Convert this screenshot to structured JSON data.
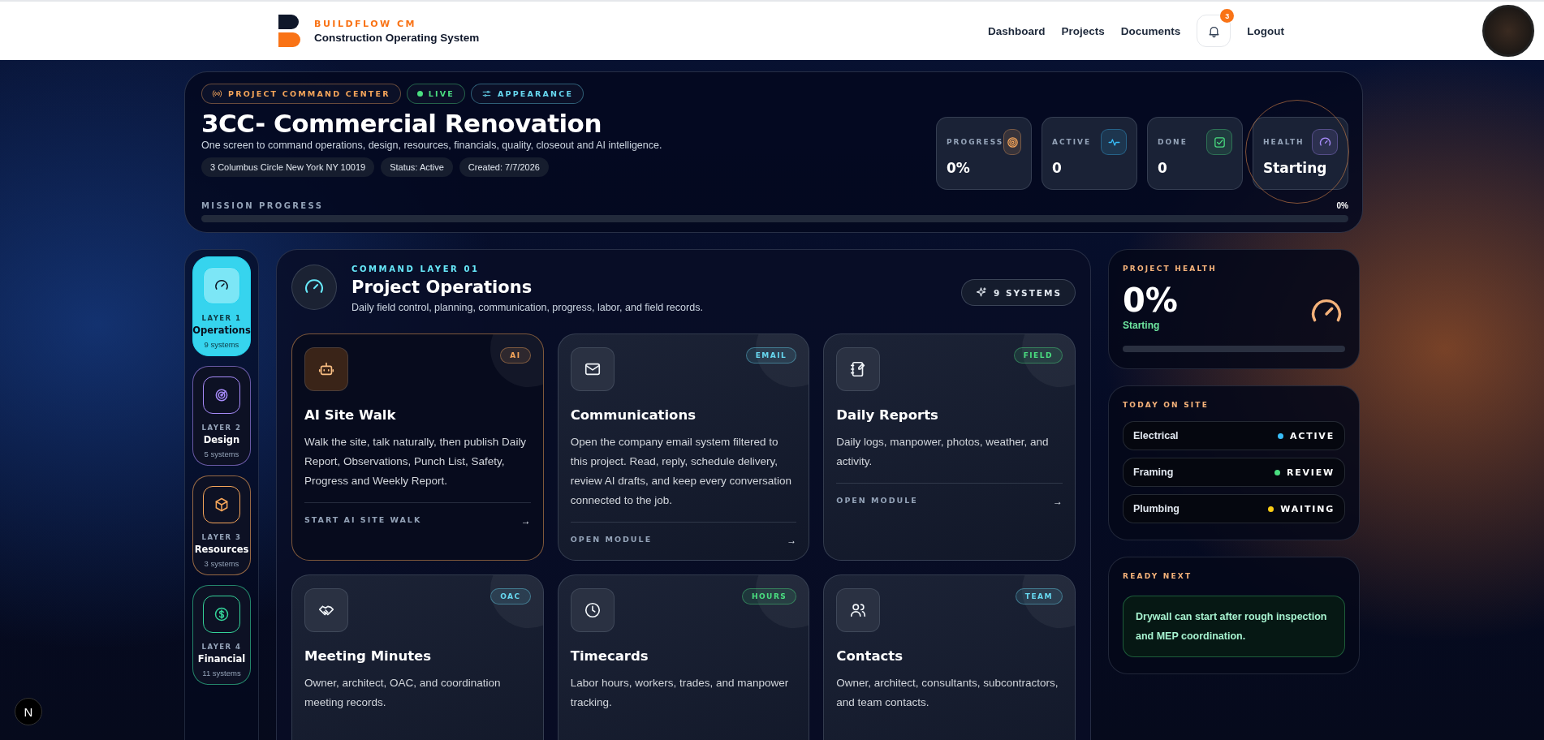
{
  "header": {
    "brand": "BUILDFLOW CM",
    "tagline": "Construction Operating System",
    "nav": [
      "Dashboard",
      "Projects",
      "Documents"
    ],
    "notifications": "3",
    "logout": "Logout"
  },
  "hero": {
    "chips": [
      {
        "label": "PROJECT COMMAND CENTER",
        "color": "#f5a55a"
      },
      {
        "label": "LIVE",
        "color": "#4ade80"
      },
      {
        "label": "APPEARANCE",
        "color": "#67d8f0"
      }
    ],
    "title": "3CC- Commercial Renovation",
    "subtitle": "One screen to command operations, design, resources, financials, quality, closeout and AI intelligence.",
    "meta": [
      "3 Columbus Circle New York NY 10019",
      "Status: Active",
      "Created: 7/7/2026"
    ],
    "stats": [
      {
        "label": "PROGRESS",
        "value": "0%",
        "color": "#f5a55a"
      },
      {
        "label": "ACTIVE",
        "value": "0",
        "color": "#38bdf8"
      },
      {
        "label": "DONE",
        "value": "0",
        "color": "#4ade80"
      },
      {
        "label": "HEALTH",
        "value": "Starting",
        "color": "#a78bfa"
      }
    ],
    "progress_label": "MISSION PROGRESS",
    "progress_reading": "0%",
    "level": 0
  },
  "layers": [
    {
      "layer": "LAYER 1",
      "name": "Operations",
      "count": "9 systems",
      "selected": true,
      "color": "#22d3ee"
    },
    {
      "layer": "LAYER 2",
      "name": "Design",
      "count": "5 systems",
      "selected": false,
      "color": "#a78bfa"
    },
    {
      "layer": "LAYER 3",
      "name": "Resources",
      "count": "3 systems",
      "selected": false,
      "color": "#f5a55a"
    },
    {
      "layer": "LAYER 4",
      "name": "Financial",
      "count": "11 systems",
      "selected": false,
      "color": "#34d399"
    }
  ],
  "operations": {
    "eyebrow": "COMMAND LAYER 01",
    "title": "Project Operations",
    "description": "Daily field control, planning, communication, progress, labor, and field records.",
    "systems": "9 SYSTEMS",
    "cards": [
      {
        "tag": "AI",
        "color": "#f5a55a",
        "title": "AI Site Walk",
        "description": "Walk the site, talk naturally, then publish Daily Report, Observations, Punch List, Safety, Progress and Weekly Report.",
        "action": "START AI SITE WALK",
        "arrow": "→",
        "selected": true
      },
      {
        "tag": "EMAIL",
        "color": "#67d8f0",
        "title": "Communications",
        "description": "Open the company email system filtered to this project. Read, reply, schedule delivery, review AI drafts, and keep every conversation connected to the job.",
        "action": "OPEN MODULE",
        "arrow": "→",
        "selected": false
      },
      {
        "tag": "FIELD",
        "color": "#4ade80",
        "title": "Daily Reports",
        "description": "Daily logs, manpower, photos, weather, and activity.",
        "action": "OPEN MODULE",
        "arrow": "→",
        "selected": false
      },
      {
        "tag": "OAC",
        "color": "#67d8f0",
        "title": "Meeting Minutes",
        "description": "Owner, architect, OAC, and coordination meeting records.",
        "selected": false
      },
      {
        "tag": "HOURS",
        "color": "#4ade80",
        "title": "Timecards",
        "description": "Labor hours, workers, trades, and manpower tracking.",
        "selected": false
      },
      {
        "tag": "TEAM",
        "color": "#67d8f0",
        "title": "Contacts",
        "description": "Owner, architect, consultants, subcontractors, and team contacts.",
        "selected": false
      }
    ]
  },
  "health": {
    "label": "PROJECT HEALTH",
    "value": "0%",
    "status": "Starting",
    "level": 0
  },
  "today": {
    "label": "TODAY ON SITE",
    "items": [
      {
        "trade": "Electrical",
        "status": "ACTIVE",
        "color": "#38bdf8"
      },
      {
        "trade": "Framing",
        "status": "REVIEW",
        "color": "#4ade80"
      },
      {
        "trade": "Plumbing",
        "status": "WAITING",
        "color": "#facc15"
      }
    ]
  },
  "ready": {
    "label": "READY NEXT",
    "text": "Drywall can start after rough inspection and MEP coordination."
  },
  "dev_badge": "N"
}
